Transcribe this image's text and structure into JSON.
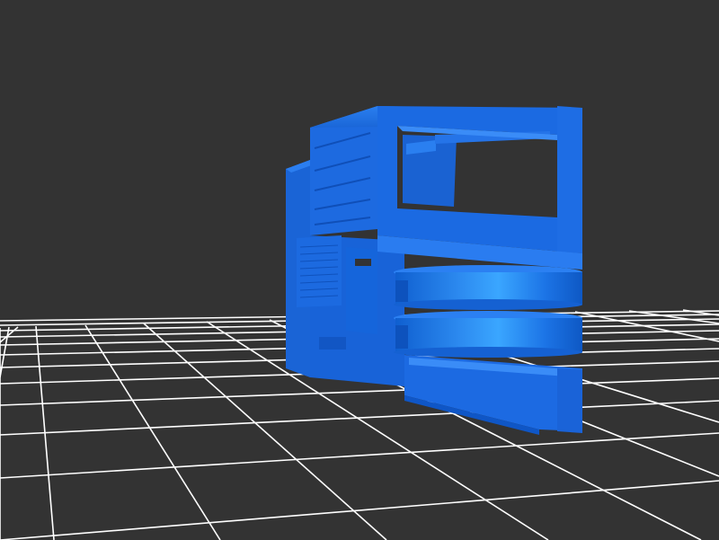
{
  "viewer": {
    "background_color": "#333333",
    "grid_color": "#ffffff",
    "model_color": "#1e6fe0",
    "model_highlight_color": "#3aa0ff",
    "model_shadow_color": "#0d4fb0"
  }
}
